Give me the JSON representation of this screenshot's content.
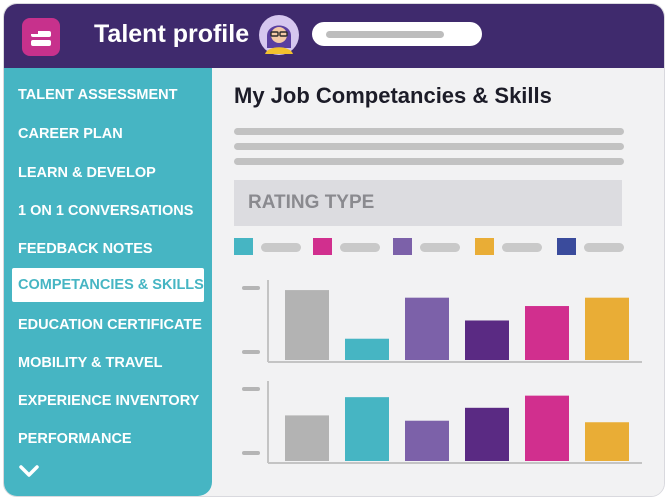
{
  "header": {
    "title": "Talent profile",
    "app_icon": "app-logo-icon",
    "avatar_icon": "user-avatar-icon",
    "search_placeholder_icon": "search-bar-placeholder"
  },
  "sidebar": {
    "items": [
      {
        "label": "TALENT ASSESSMENT",
        "active": false
      },
      {
        "label": "CAREER PLAN",
        "active": false
      },
      {
        "label": "LEARN & DEVELOP",
        "active": false
      },
      {
        "label": "1 ON 1 CONVERSATIONS",
        "active": false
      },
      {
        "label": "FEEDBACK NOTES",
        "active": false
      },
      {
        "label": "COMPETANCIES & SKILLS",
        "active": true
      },
      {
        "label": "EDUCATION CERTIFICATE",
        "active": false
      },
      {
        "label": "MOBILITY & TRAVEL",
        "active": false
      },
      {
        "label": "EXPERIENCE INVENTORY",
        "active": false
      },
      {
        "label": "PERFORMANCE",
        "active": false
      }
    ],
    "expand_icon": "chevron-down-icon"
  },
  "main": {
    "title": "My Job Competancies & Skills",
    "rating_label": "RATING TYPE"
  },
  "colors": {
    "header_bg": "#3f2a6d",
    "sidebar_bg": "#46b5c3",
    "accent_pink": "#c7318c",
    "series": [
      "#46b5c3",
      "#d12f8e",
      "#7c61a9",
      "#e9ad36",
      "#3a4b9c"
    ]
  },
  "chart_data": [
    {
      "type": "bar",
      "bars": [
        {
          "value": 0.92,
          "color": "#b3b3b3"
        },
        {
          "value": 0.28,
          "color": "#46b5c3"
        },
        {
          "value": 0.82,
          "color": "#7c61a9"
        },
        {
          "value": 0.52,
          "color": "#5a2a83"
        },
        {
          "value": 0.71,
          "color": "#d12f8e"
        },
        {
          "value": 0.82,
          "color": "#e9ad36"
        }
      ]
    },
    {
      "type": "bar",
      "bars": [
        {
          "value": 0.6,
          "color": "#b3b3b3"
        },
        {
          "value": 0.84,
          "color": "#46b5c3"
        },
        {
          "value": 0.53,
          "color": "#7c61a9"
        },
        {
          "value": 0.7,
          "color": "#5a2a83"
        },
        {
          "value": 0.86,
          "color": "#d12f8e"
        },
        {
          "value": 0.51,
          "color": "#e9ad36"
        }
      ]
    }
  ]
}
